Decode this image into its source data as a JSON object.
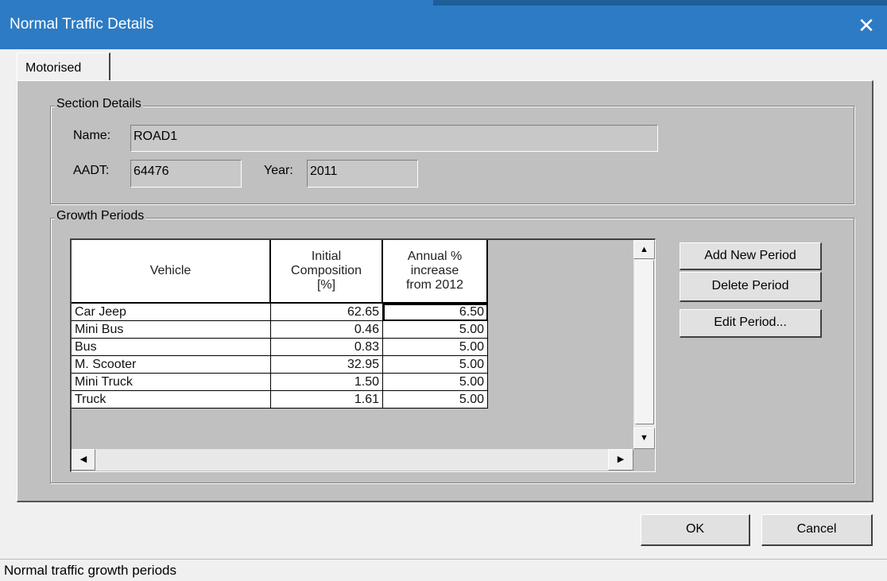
{
  "window": {
    "title": "Normal Traffic Details",
    "close_glyph": "✕"
  },
  "tabs": [
    {
      "label": "Motorised"
    }
  ],
  "section_details": {
    "legend": "Section Details",
    "name_label": "Name:",
    "name_value": "ROAD1",
    "aadt_label": "AADT:",
    "aadt_value": "64476",
    "year_label": "Year:",
    "year_value": "2011"
  },
  "growth_periods": {
    "legend": "Growth Periods",
    "columns": [
      "Vehicle",
      "Initial Composition [%]",
      "Annual % increase from 2012"
    ],
    "rows": [
      [
        "Car Jeep",
        "62.65",
        "6.50"
      ],
      [
        "Mini Bus",
        "0.46",
        "5.00"
      ],
      [
        "Bus",
        "0.83",
        "5.00"
      ],
      [
        "M. Scooter",
        "32.95",
        "5.00"
      ],
      [
        "Mini Truck",
        "1.50",
        "5.00"
      ],
      [
        "Truck",
        "1.61",
        "5.00"
      ]
    ],
    "buttons": {
      "add": "Add New Period",
      "delete": "Delete Period",
      "edit": "Edit Period..."
    }
  },
  "dialog_buttons": {
    "ok": "OK",
    "cancel": "Cancel"
  },
  "status_bar": "Normal traffic growth periods",
  "colors": {
    "title_bar": "#2d7bc4",
    "panel": "#c0c0c0",
    "window": "#f0f0f0"
  }
}
